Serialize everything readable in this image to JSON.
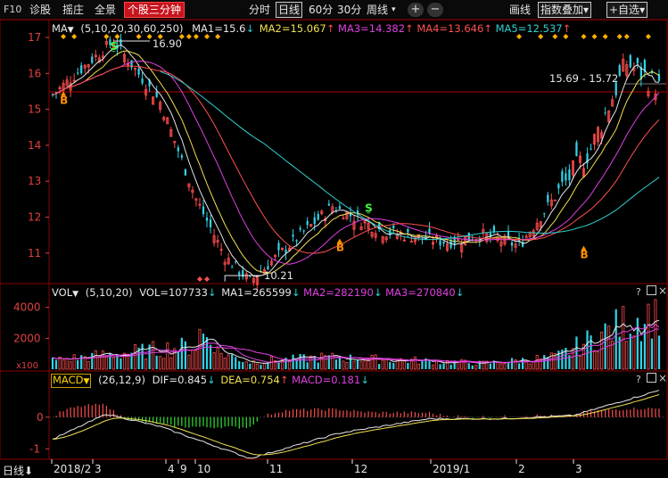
{
  "toolbar": {
    "f10": "F10",
    "diagnose": "诊股",
    "pick": "摇庄",
    "fullview": "全景",
    "stock3min": "个股三分钟",
    "periods": [
      "分时",
      "日线",
      "60分",
      "30分",
      "周线"
    ],
    "period_dropdown": "▾",
    "zoom_in": "+",
    "zoom_out": "−",
    "draw": "画线",
    "index_overlay": "指数叠加",
    "add_watch": "+自选"
  },
  "legends": {
    "ma": {
      "name": "MA",
      "params": "(5,10,20,30,60,250)",
      "ma1": "MA1=15.6",
      "ma2": "MA2=15.067",
      "ma3": "MA3=14.382",
      "ma4": "MA4=13.646",
      "ma5": "MA5=12.537"
    },
    "vol": {
      "name": "VOL",
      "params": "(5,10,20)",
      "vol": "VOL=107733",
      "ma1": "MA1=265599",
      "ma2": "MA2=282190",
      "ma3": "MA3=270840"
    },
    "macd": {
      "name": "MACD",
      "params": "(26,12,9)",
      "dif": "DIF=0.845",
      "dea": "DEA=0.754",
      "macd": "MACD=0.181"
    }
  },
  "annotations": {
    "high_label": "16.90",
    "low_label": "10.21",
    "range_label": "15.69 - 15.72",
    "buy_marker": "B",
    "sell_marker": "S",
    "vol_unit": "x100"
  },
  "bottom": {
    "period_label": "日线"
  },
  "colors": {
    "up": "#ff4d4d",
    "down": "#32d2e6",
    "ma1": "#e6e6e6",
    "ma2": "#f0e050",
    "ma3": "#e040e0",
    "ma4": "#ff5050",
    "ma5": "#30d0d0",
    "axis_red": "#8c0000",
    "macd_dif": "#e6e6e6",
    "macd_dea": "#f0e050",
    "signal_s": "#40ff40",
    "signal_b": "#ff9000"
  },
  "chart_data": [
    {
      "type": "candlestick",
      "title": "日线",
      "y_ticks": [
        11,
        12,
        13,
        14,
        15,
        16,
        17
      ],
      "ylim": [
        10.2,
        17.1
      ],
      "x_ticks": [
        "2018/2",
        "3",
        "4",
        "9",
        "10",
        "11",
        "12",
        "2019/1",
        "2",
        "3"
      ],
      "close_anchors": [
        {
          "x": "2018/2",
          "y": 15.4
        },
        {
          "x": "3",
          "y": 16.3
        },
        {
          "x": "3",
          "y": 16.9
        },
        {
          "x": "4",
          "y": 15.2
        },
        {
          "x": "9",
          "y": 12.5
        },
        {
          "x": "10",
          "y": 10.9
        },
        {
          "x": "10",
          "y": 10.21
        },
        {
          "x": "11",
          "y": 11.4
        },
        {
          "x": "11",
          "y": 12.3
        },
        {
          "x": "12",
          "y": 11.6
        },
        {
          "x": "2019/1",
          "y": 11.3
        },
        {
          "x": "2019/1",
          "y": 11.5
        },
        {
          "x": "2",
          "y": 11.2
        },
        {
          "x": "2",
          "y": 12.3
        },
        {
          "x": "3",
          "y": 13.9
        },
        {
          "x": "3",
          "y": 16.3
        },
        {
          "x": "3",
          "y": 15.6
        }
      ],
      "markers": [
        {
          "type": "B",
          "x": "2018/2",
          "y": 15.6
        },
        {
          "type": "S",
          "x": "3",
          "y": 16.5
        },
        {
          "type": "S",
          "x": "11",
          "y": 12.0
        },
        {
          "type": "B",
          "x": "11",
          "y": 11.5
        },
        {
          "type": "B",
          "x": "2",
          "y": 11.3
        }
      ],
      "series_last": [
        {
          "name": "MA1",
          "value": 15.6
        },
        {
          "name": "MA2",
          "value": 15.067
        },
        {
          "name": "MA3",
          "value": 14.382
        },
        {
          "name": "MA4",
          "value": 13.646
        },
        {
          "name": "MA5",
          "value": 12.537
        }
      ]
    },
    {
      "type": "bar",
      "title": "VOL",
      "y_ticks": [
        2000,
        4000
      ],
      "ylim": [
        0,
        4500
      ],
      "volume_anchors": [
        {
          "x": "2018/2",
          "y": 600
        },
        {
          "x": "4",
          "y": 1600
        },
        {
          "x": "10",
          "y": 500
        },
        {
          "x": "11",
          "y": 800
        },
        {
          "x": "12",
          "y": 600
        },
        {
          "x": "2019/1",
          "y": 400
        },
        {
          "x": "2",
          "y": 800
        },
        {
          "x": "3",
          "y": 3200
        },
        {
          "x": "3",
          "y": 4000
        }
      ],
      "series_last": [
        {
          "name": "VOL",
          "value": 107733
        },
        {
          "name": "MA1",
          "value": 265599
        },
        {
          "name": "MA2",
          "value": 282190
        },
        {
          "name": "MA3",
          "value": 270840
        }
      ]
    },
    {
      "type": "line",
      "title": "MACD",
      "y_ticks": [
        -1,
        0
      ],
      "ylim": [
        -1.3,
        0.95
      ],
      "dif_anchors": [
        {
          "x": "2018/2",
          "y": -0.7
        },
        {
          "x": "3",
          "y": 0.1
        },
        {
          "x": "4",
          "y": -0.3
        },
        {
          "x": "10",
          "y": -1.3
        },
        {
          "x": "11",
          "y": -0.5
        },
        {
          "x": "12",
          "y": -0.05
        },
        {
          "x": "2019/1",
          "y": -0.05
        },
        {
          "x": "2",
          "y": 0.05
        },
        {
          "x": "3",
          "y": 0.845
        }
      ],
      "series_last": [
        {
          "name": "DIF",
          "value": 0.845
        },
        {
          "name": "DEA",
          "value": 0.754
        },
        {
          "name": "MACD",
          "value": 0.181
        }
      ]
    }
  ]
}
